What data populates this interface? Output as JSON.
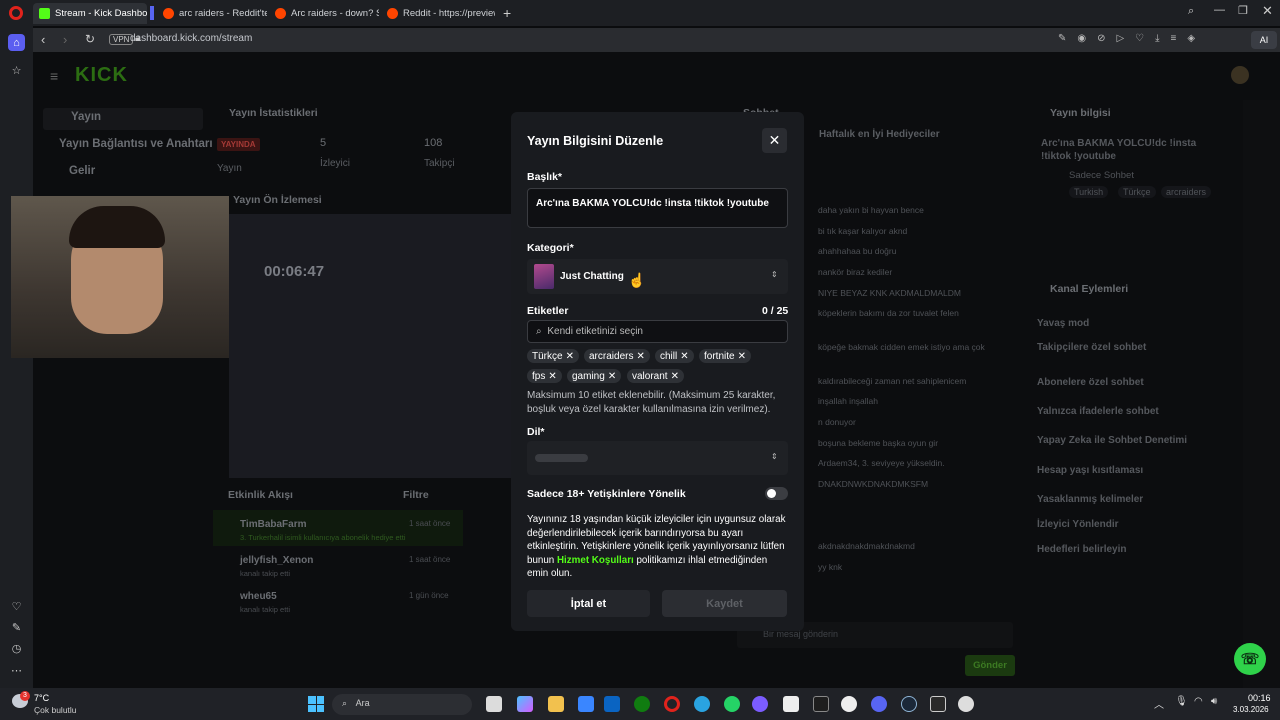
{
  "browser": {
    "tabs": [
      {
        "label": "Stream - Kick Dashboard",
        "icon": "kick-favicon"
      },
      {
        "label": "arc raiders - Reddit'te ara",
        "icon": "reddit-favicon"
      },
      {
        "label": "Arc raiders - down? Server",
        "icon": "reddit-favicon"
      },
      {
        "label": "Reddit - https://preview.re",
        "icon": "reddit-favicon"
      }
    ],
    "url": "dashboard.kick.com/stream",
    "vpn": "VPN",
    "ai_label": "AI"
  },
  "dashboard": {
    "logo": "KICK",
    "nav": [
      "Yayın",
      "Yayın Bağlantısı ve Anahtarı",
      "Gelir"
    ],
    "stats_title": "Yayın İstatistikleri",
    "stats": [
      {
        "value": "YAYINDA",
        "label": "Yayın"
      },
      {
        "value": "5",
        "label": "İzleyici"
      },
      {
        "value": "108",
        "label": "Takipçi"
      }
    ],
    "preview_title": "Yayın Ön İzlemesi",
    "preview_timer": "00:06:47",
    "activity_title": "Etkinlik Akışı",
    "activity_filter": "Filtre",
    "activity": [
      {
        "user": "TimBabaFarm",
        "text": "3. Turkerhalil isimli kullanıcıya abonelik hediye etti",
        "time": "1 saat önce"
      },
      {
        "user": "jellyfish_Xenon",
        "text": "kanalı takip etti",
        "time": "1 saat önce"
      },
      {
        "user": "wheu65",
        "text": "kanalı takip etti",
        "time": "1 gün önce"
      }
    ],
    "chat_title": "Sohbet",
    "chat_gifters": "Haftalık en İyi Hediyeciler",
    "chat_lines": [
      "daha yakın bi hayvan bence",
      "bi tık kaşar kalıyor aknd",
      "ahahhahaa bu doğru",
      "nankör biraz kediler",
      "NIYE BEYAZ KNK AKDMALDMALDM",
      "köpeklerin bakımı da zor tuvalet felen",
      "köpeğe bakmak cidden emek istiyo ama çok",
      "kaldırabileceği zaman net sahiplenicem",
      "inşallah inşallah",
      "n donuyor",
      "boşuna bekleme başka oyun gir",
      "Ardaem34, 3. seviyeye yükseldin.",
      "DNAKDNWKDNAKDMKSFM",
      "akdnakdnakdmakdnakmd",
      "yy knk"
    ],
    "chat_placeholder": "Bir mesaj gönderin",
    "chat_send": "Gönder",
    "info_title": "Yayın bilgisi",
    "info_stream_title": "Arc'ına BAKMA YOLCU!dc !insta !tiktok !youtube",
    "info_category": "Sadece Sohbet",
    "info_tags": [
      "Turkish",
      "Türkçe",
      "arcraiders"
    ],
    "actions_title": "Kanal Eylemleri",
    "actions": [
      "Yavaş mod",
      "Takipçilere özel sohbet",
      "Abonelere özel sohbet",
      "Yalnızca ifadelerle sohbet",
      "Yapay Zeka ile Sohbet Denetimi",
      "Hesap yaşı kısıtlaması",
      "Yasaklanmış kelimeler",
      "İzleyici Yönlendir",
      "Hedefleri belirleyin"
    ]
  },
  "modal": {
    "title": "Yayın Bilgisini Düzenle",
    "title_label": "Başlık*",
    "title_value": "Arc'ına BAKMA YOLCU!dc !insta !tiktok !youtube",
    "category_label": "Kategori*",
    "category_value": "Just Chatting",
    "tags_label": "Etiketler",
    "tags_count": "0 / 25",
    "tags_placeholder": "Kendi etiketinizi seçin",
    "tags": [
      "Türkçe",
      "arcraiders",
      "chill",
      "fortnite",
      "fps",
      "gaming",
      "valorant"
    ],
    "tags_hint": "Maksimum 10 etiket eklenebilir. (Maksimum 25 karakter, boşluk veya özel karakter kullanılmasına izin verilmez).",
    "language_label": "Dil*",
    "adult_label": "Sadece 18+ Yetişkinlere Yönelik",
    "adult_on": false,
    "adult_notice_1": "Yayınınız 18 yaşından küçük izleyiciler için uygunsuz olarak değerlendirilebilecek içerik barındırıyorsa bu ayarı etkinleştirin. Yetişkinlere yönelik içerik yayınlıyorsanız lütfen bunun ",
    "adult_notice_link": "Hizmet Koşulları",
    "adult_notice_2": " politikamızı ihlal etmediğinden emin olun.",
    "cancel": "İptal et",
    "save": "Kaydet"
  },
  "taskbar": {
    "weather_temp": "7°C",
    "weather_desc": "Çok bulutlu",
    "search": "Ara",
    "time": "00:16",
    "date": "3.03.2026",
    "notification_count": "3"
  },
  "colors": {
    "kick_green": "#53fc18",
    "live_red": "#e5322d",
    "modal_bg": "#191b1f"
  }
}
